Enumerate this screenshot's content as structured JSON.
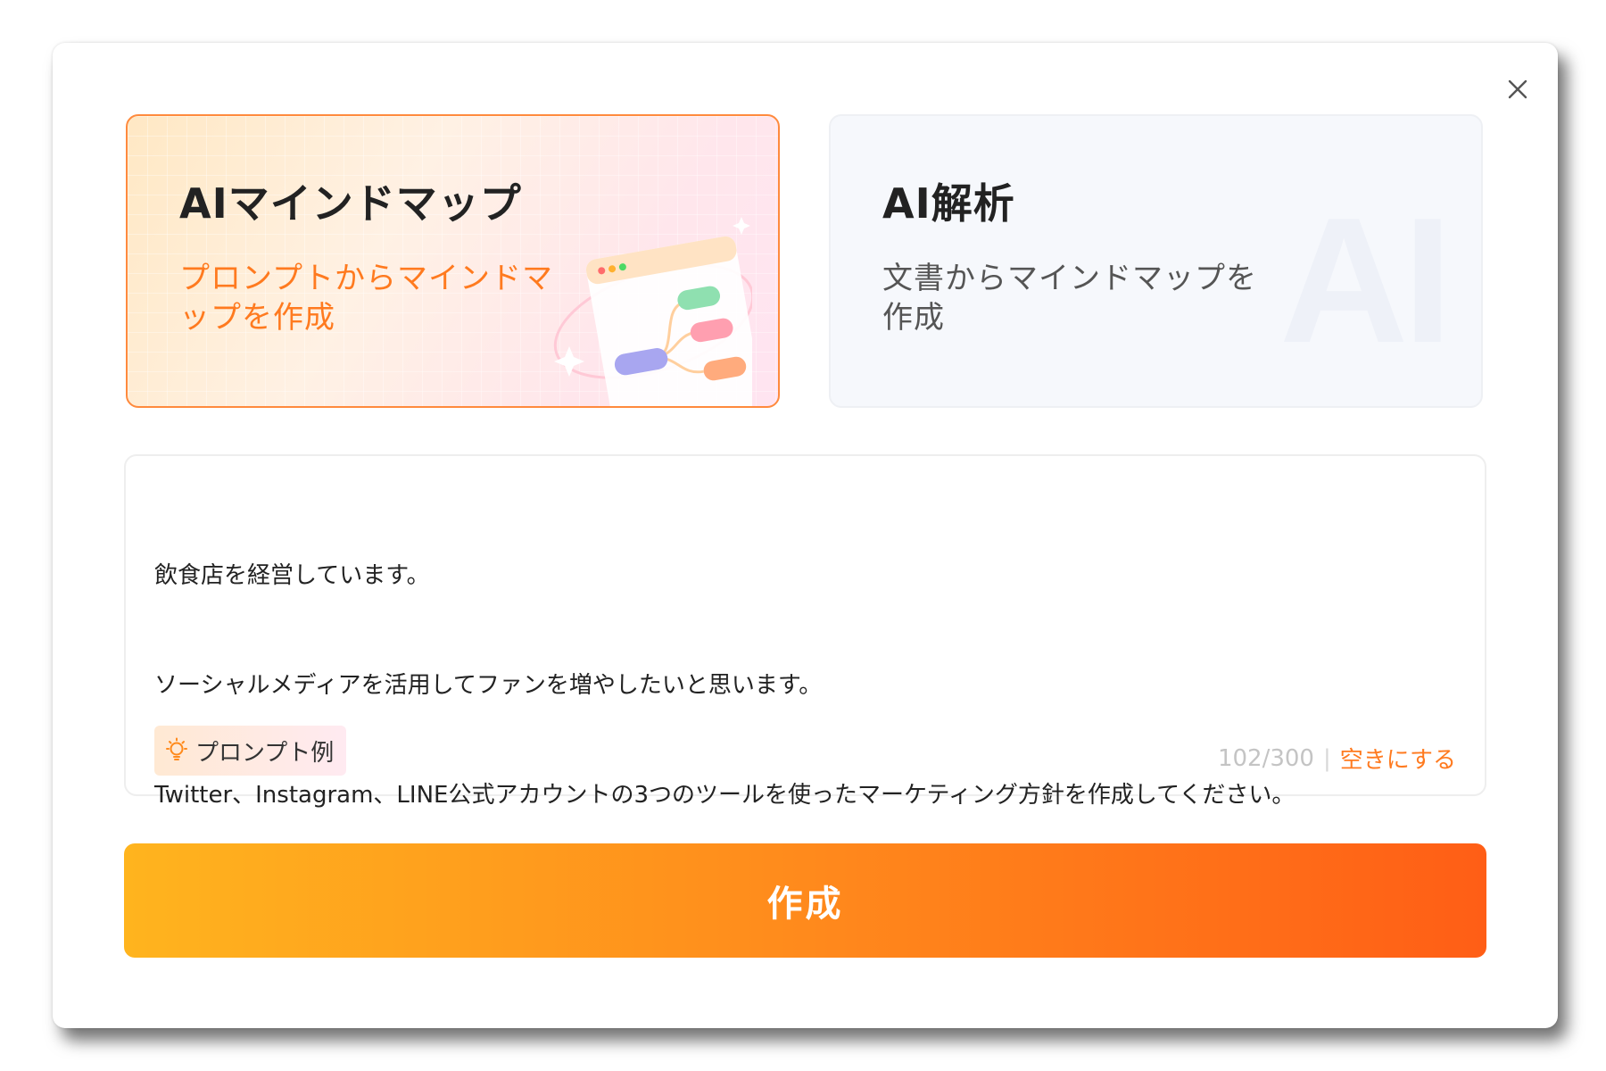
{
  "dialog": {
    "close_icon": "close-icon"
  },
  "cards": {
    "ai_mindmap": {
      "title": "AIマインドマップ",
      "description": "プロンプトからマインドマップを作成",
      "selected": true,
      "accent_color": "#ff7a1f"
    },
    "ai_analysis": {
      "title": "AI解析",
      "description": "文書からマインドマップを作成",
      "watermark": "AI",
      "selected": false
    }
  },
  "prompt": {
    "lines": [
      "飲食店を経営しています。",
      "ソーシャルメディアを活用してファンを増やしたいと思います。",
      "Twitter、Instagram、LINE公式アカウントの3つのツールを使ったマーケティング方針を作成してください。"
    ],
    "examples_label": "プロンプト例",
    "examples_icon": "lightbulb-icon",
    "counter": "102/300",
    "divider": "|",
    "clear_label": "空きにする"
  },
  "create_button": {
    "label": "作成",
    "gradient": [
      "#ffb41e",
      "#ff5e16"
    ]
  }
}
